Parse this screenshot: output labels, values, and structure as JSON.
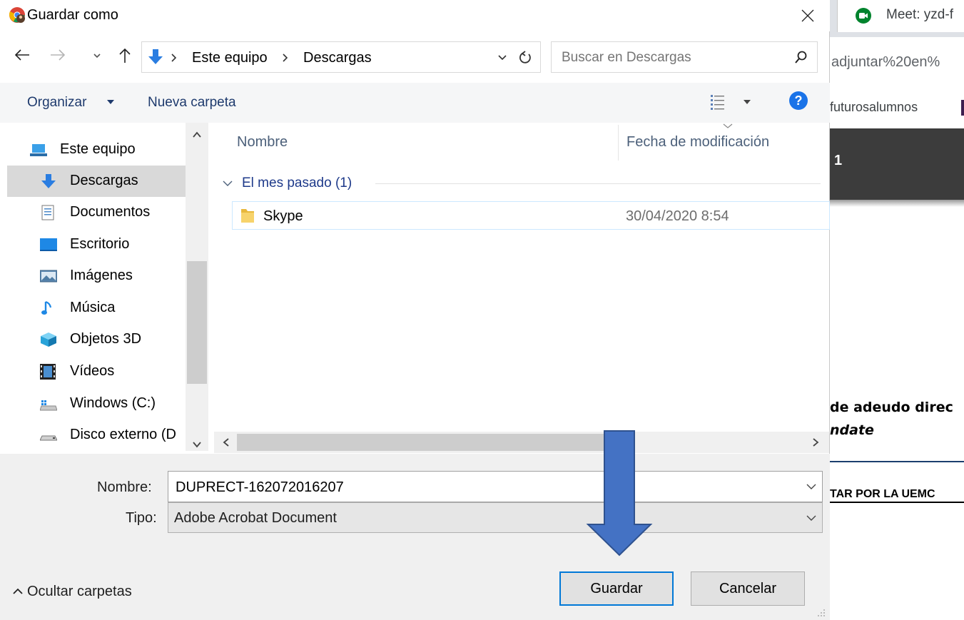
{
  "background_browser": {
    "tab_title": "Meet: yzd-f",
    "url_fragment": "adjuntar%20en%",
    "bookmark": "futurosalumnos",
    "banner_text": "1",
    "page_heading": "de adeudo direc",
    "page_subheading": "ndate",
    "page_link": "TAR POR LA UEMC"
  },
  "dialog": {
    "title": "Guardar como",
    "breadcrumb": [
      "Este equipo",
      "Descargas"
    ],
    "search_placeholder": "Buscar en Descargas",
    "toolbar": {
      "organize": "Organizar",
      "new_folder": "Nueva carpeta"
    },
    "nav_items": [
      {
        "label": "Este equipo",
        "icon": "computer-icon"
      },
      {
        "label": "Descargas",
        "icon": "download-arrow-icon",
        "selected": true
      },
      {
        "label": "Documentos",
        "icon": "documents-icon"
      },
      {
        "label": "Escritorio",
        "icon": "desktop-icon"
      },
      {
        "label": "Imágenes",
        "icon": "pictures-icon"
      },
      {
        "label": "Música",
        "icon": "music-icon"
      },
      {
        "label": "Objetos 3D",
        "icon": "3d-objects-icon"
      },
      {
        "label": "Vídeos",
        "icon": "videos-icon"
      },
      {
        "label": "Windows (C:)",
        "icon": "drive-icon"
      },
      {
        "label": "Disco externo (D",
        "icon": "external-drive-icon"
      }
    ],
    "columns": {
      "name": "Nombre",
      "modified": "Fecha de modificación"
    },
    "group": {
      "label": "El mes pasado (1)"
    },
    "files": [
      {
        "name": "Skype",
        "modified": "30/04/2020 8:54"
      }
    ],
    "filename_label": "Nombre:",
    "filename_value": "DUPRECT-162072016207",
    "filetype_label": "Tipo:",
    "filetype_value": "Adobe Acrobat Document",
    "hide_folders": "Ocultar carpetas",
    "save": "Guardar",
    "cancel": "Cancelar"
  },
  "colors": {
    "accent": "#0078d7",
    "folder": "#e8b83c",
    "arrow": "#4472c4",
    "link_blue": "#1e3a6d"
  }
}
